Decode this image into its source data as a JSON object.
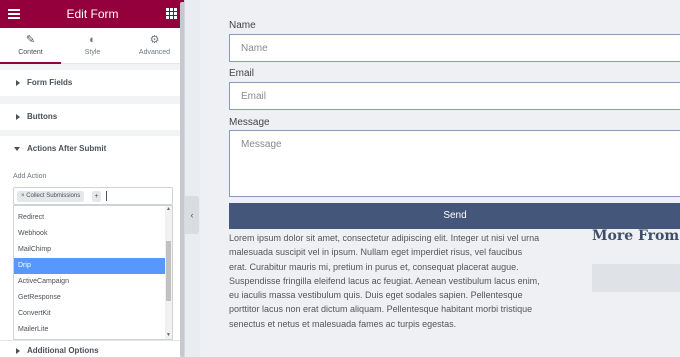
{
  "panel": {
    "title": "Edit Form",
    "tabs": [
      {
        "label": "Content",
        "icon": "pencil-icon"
      },
      {
        "label": "Style",
        "icon": "half-circle-icon"
      },
      {
        "label": "Advanced",
        "icon": "gear-icon"
      }
    ],
    "sections": {
      "form_fields": "Form Fields",
      "buttons": "Buttons",
      "actions_after_submit": "Actions After Submit",
      "additional_options": "Additional Options"
    },
    "add_action": {
      "label": "Add Action",
      "selected_chip": "Collect Submissions",
      "chip_remove": "×",
      "add_symbol": "+"
    },
    "dropdown_options": [
      "Redirect",
      "Webhook",
      "MailChimp",
      "Drip",
      "ActiveCampaign",
      "GetResponse",
      "ConvertKit",
      "MailerLite"
    ],
    "highlighted_option": "Drip",
    "colors": {
      "header": "#93003c",
      "highlight": "#5897fb"
    }
  },
  "form": {
    "name_label": "Name",
    "name_placeholder": "Name",
    "email_label": "Email",
    "email_placeholder": "Email",
    "message_label": "Message",
    "message_placeholder": "Message",
    "send_label": "Send",
    "button_color": "#44577a"
  },
  "content": {
    "lorem": "Lorem ipsum dolor sit amet, consectetur adipiscing elit. Integer ut nisi vel urna malesuada suscipit vel in ipsum. Nullam eget imperdiet risus, vel faucibus erat. Curabitur mauris mi, pretium in purus et, consequat placerat augue. Suspendisse fringilla eleifend lacus ac feugiat. Aenean vestibulum lacus enim, eu iaculis massa vestibulum quis. Duis eget sodales sapien. Pellentesque porttitor lacus non erat dictum aliquam. Pellentesque habitant morbi tristique senectus et netus et malesuada fames ac turpis egestas.",
    "more_from": "More From"
  }
}
